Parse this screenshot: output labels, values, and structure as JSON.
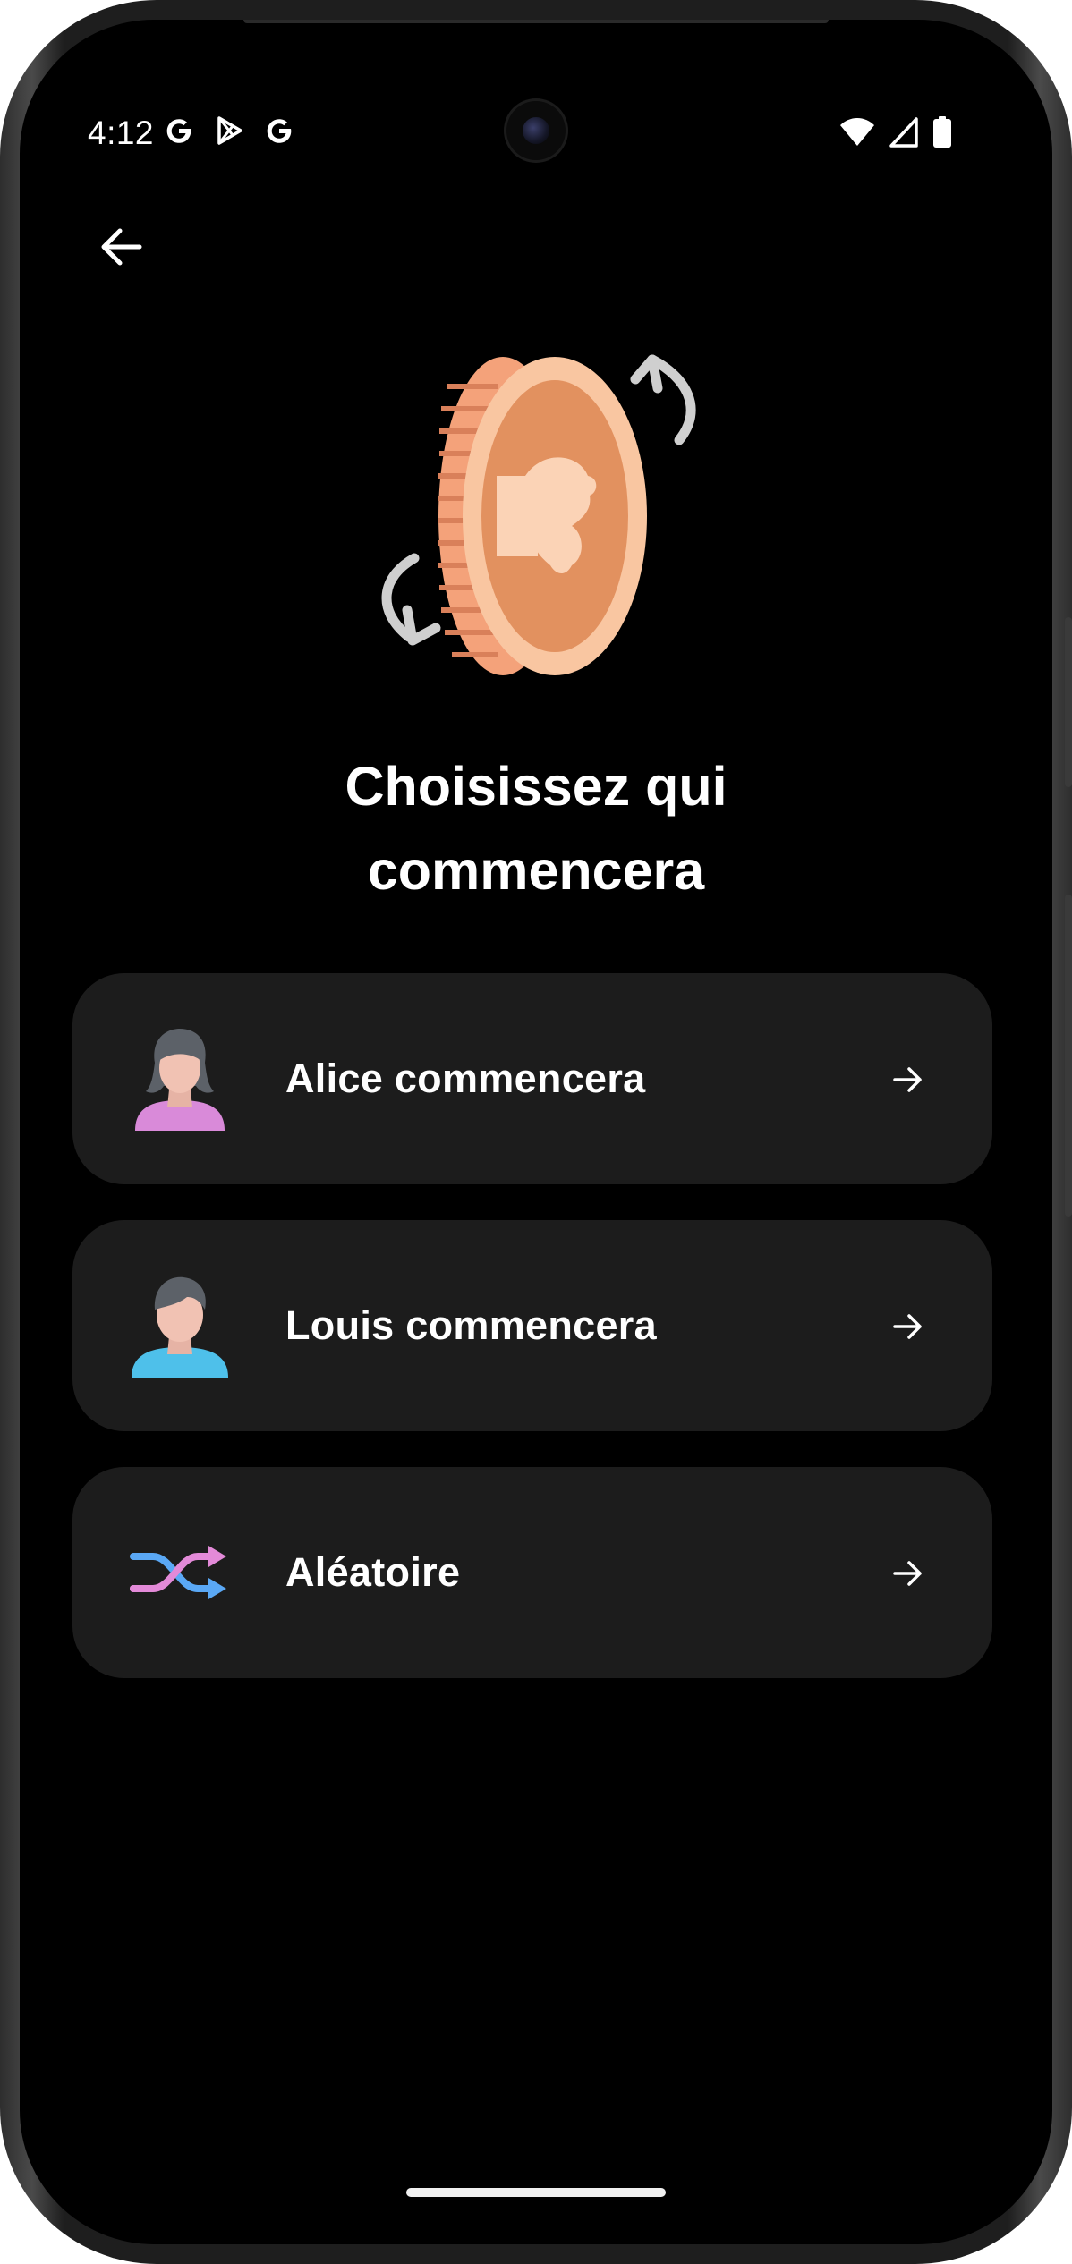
{
  "status_bar": {
    "time": "4:12",
    "left_icons": [
      "google-icon",
      "play-store-icon",
      "google-icon"
    ],
    "right_icons": [
      "wifi-icon",
      "cellular-signal-icon",
      "battery-icon"
    ]
  },
  "header": {
    "back_icon": "arrow-left-icon"
  },
  "illustration": {
    "name": "coin-flip-illustration"
  },
  "title": {
    "line1": "Choisissez qui",
    "line2": "commencera"
  },
  "options": [
    {
      "label": "Alice commencera",
      "icon": "female-avatar-icon"
    },
    {
      "label": "Louis commencera",
      "icon": "male-avatar-icon"
    },
    {
      "label": "Aléatoire",
      "icon": "shuffle-icon"
    }
  ],
  "colors": {
    "background": "#000000",
    "card": "#1c1c1c",
    "text": "#ffffff",
    "coin_light": "#f8c6a0",
    "coin_dark": "#e0905f",
    "shuffle_pink": "#e38ad8",
    "shuffle_blue": "#5aa8f5"
  }
}
